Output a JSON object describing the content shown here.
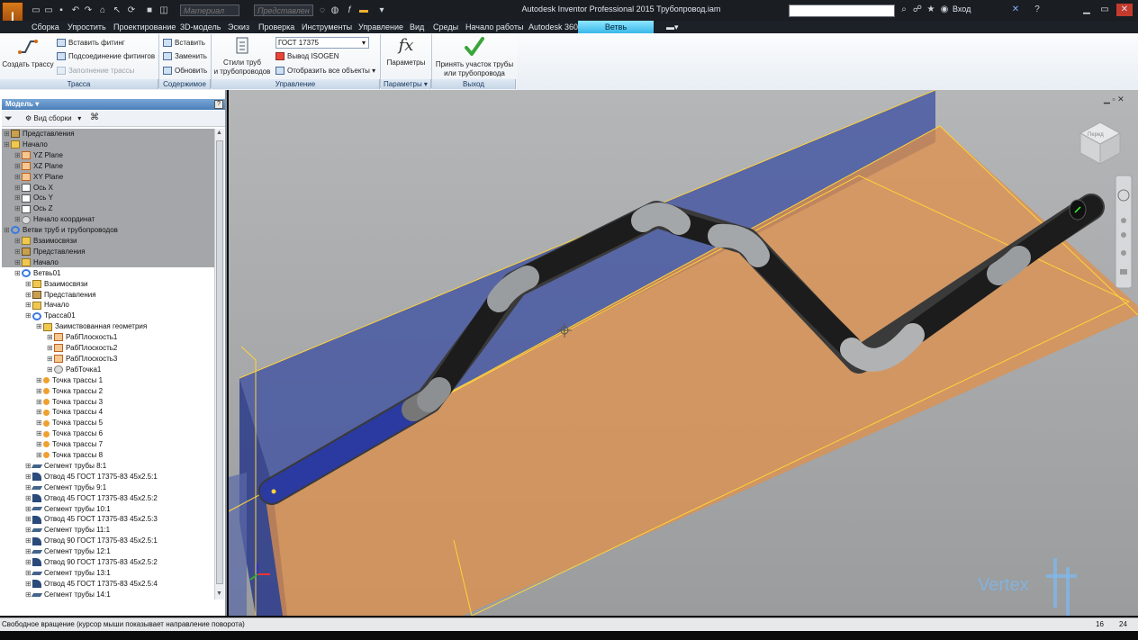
{
  "window": {
    "title": "Autodesk Inventor Professional 2015   Трубопровод.iam",
    "login_label": "Вход",
    "app_button": "I",
    "app_sub": "PRO"
  },
  "qat": {
    "material_placeholder": "Материал",
    "representation_placeholder": "Представлен"
  },
  "menu": {
    "tabs": [
      "Сборка",
      "Упростить",
      "Проектирование",
      "3D-модель",
      "Эскиз",
      "Проверка",
      "Инструменты",
      "Управление",
      "Вид",
      "Среды",
      "Начало работы",
      "Autodesk 360"
    ],
    "active_tab": "Ветвь трубопровода"
  },
  "ribbon": {
    "create_route": "Создать трассу",
    "insert_fitting": "Вставить фитинг",
    "connect_fittings": "Подсоединение фитингов",
    "fill_route": "Заполнение трассы",
    "insert": "Вставить",
    "replace": "Заменить",
    "update": "Обновить",
    "styles_line1": "Стили труб",
    "styles_line2": "и трубопроводов",
    "style_combo": "ГОСТ 17375",
    "isogen": "Вывод ISOGEN",
    "show_all": "Отобразить все объекты",
    "params": "Параметры",
    "accept_line1": "Принять участок трубы",
    "accept_line2": "или трубопровода",
    "panels": {
      "route": "Трасса",
      "content": "Содержимое",
      "manage": "Управление",
      "params": "Параметры",
      "exit": "Выход"
    }
  },
  "browser": {
    "header": "Модель",
    "view_mode": "Вид сборки",
    "help": "?",
    "items": [
      {
        "label": "Представления",
        "indent": 0,
        "icon": "repr"
      },
      {
        "label": "Начало",
        "indent": 0,
        "icon": "folder"
      },
      {
        "label": "YZ Plane",
        "indent": 2,
        "icon": "plane"
      },
      {
        "label": "XZ Plane",
        "indent": 2,
        "icon": "plane"
      },
      {
        "label": "XY Plane",
        "indent": 2,
        "icon": "plane"
      },
      {
        "label": "Ось X",
        "indent": 2,
        "icon": "axis"
      },
      {
        "label": "Ось Y",
        "indent": 2,
        "icon": "axis"
      },
      {
        "label": "Ось Z",
        "indent": 2,
        "icon": "axis"
      },
      {
        "label": "Начало координат",
        "indent": 2,
        "icon": "point"
      },
      {
        "label": "Ветви труб и трубопроводов",
        "indent": 0,
        "icon": "run"
      },
      {
        "label": "Взаимосвязи",
        "indent": 2,
        "icon": "folder"
      },
      {
        "label": "Представления",
        "indent": 2,
        "icon": "repr"
      },
      {
        "label": "Начало",
        "indent": 2,
        "icon": "folder"
      },
      {
        "label": "Ветвь01",
        "indent": 2,
        "icon": "run"
      },
      {
        "label": "Взаимосвязи",
        "indent": 4,
        "icon": "folder"
      },
      {
        "label": "Представления",
        "indent": 4,
        "icon": "repr"
      },
      {
        "label": "Начало",
        "indent": 4,
        "icon": "folder"
      },
      {
        "label": "Трасса01",
        "indent": 4,
        "icon": "run"
      },
      {
        "label": "Заимствованная геометрия",
        "indent": 6,
        "icon": "folder"
      },
      {
        "label": "РабПлоскость1",
        "indent": 8,
        "icon": "plane"
      },
      {
        "label": "РабПлоскость2",
        "indent": 8,
        "icon": "plane"
      },
      {
        "label": "РабПлоскость3",
        "indent": 8,
        "icon": "plane"
      },
      {
        "label": "РабТочка1",
        "indent": 8,
        "icon": "point"
      },
      {
        "label": "Точка трассы 1",
        "indent": 6,
        "icon": "rpoint"
      },
      {
        "label": "Точка трассы 2",
        "indent": 6,
        "icon": "rpoint"
      },
      {
        "label": "Точка трассы 3",
        "indent": 6,
        "icon": "rpoint"
      },
      {
        "label": "Точка трассы 4",
        "indent": 6,
        "icon": "rpoint"
      },
      {
        "label": "Точка трассы 5",
        "indent": 6,
        "icon": "rpoint"
      },
      {
        "label": "Точка трассы 6",
        "indent": 6,
        "icon": "rpoint"
      },
      {
        "label": "Точка трассы 7",
        "indent": 6,
        "icon": "rpoint"
      },
      {
        "label": "Точка трассы 8",
        "indent": 6,
        "icon": "rpoint"
      },
      {
        "label": "Сегмент трубы 8:1",
        "indent": 4,
        "icon": "pipe"
      },
      {
        "label": "Отвод 45 ГОСТ 17375-83 45x2.5:1",
        "indent": 4,
        "icon": "elbow"
      },
      {
        "label": "Сегмент трубы 9:1",
        "indent": 4,
        "icon": "pipe"
      },
      {
        "label": "Отвод 45 ГОСТ 17375-83 45x2.5:2",
        "indent": 4,
        "icon": "elbow"
      },
      {
        "label": "Сегмент трубы 10:1",
        "indent": 4,
        "icon": "pipe"
      },
      {
        "label": "Отвод 45 ГОСТ 17375-83 45x2.5:3",
        "indent": 4,
        "icon": "elbow"
      },
      {
        "label": "Сегмент трубы 11:1",
        "indent": 4,
        "icon": "pipe"
      },
      {
        "label": "Отвод 90 ГОСТ 17375-83 45x2.5:1",
        "indent": 4,
        "icon": "elbow"
      },
      {
        "label": "Сегмент трубы 12:1",
        "indent": 4,
        "icon": "pipe"
      },
      {
        "label": "Отвод 90 ГОСТ 17375-83 45x2.5:2",
        "indent": 4,
        "icon": "elbow"
      },
      {
        "label": "Сегмент трубы 13:1",
        "indent": 4,
        "icon": "pipe"
      },
      {
        "label": "Отвод 45 ГОСТ 17375-83 45x2.5:4",
        "indent": 4,
        "icon": "elbow"
      },
      {
        "label": "Сегмент трубы 14:1",
        "indent": 4,
        "icon": "pipe"
      }
    ]
  },
  "viewport": {
    "viewcube_label": "Перед",
    "watermark": "Vertex"
  },
  "status": {
    "text": "Свободное вращение (курсор мыши показывает направление поворота)",
    "num1": "16",
    "num2": "24"
  }
}
